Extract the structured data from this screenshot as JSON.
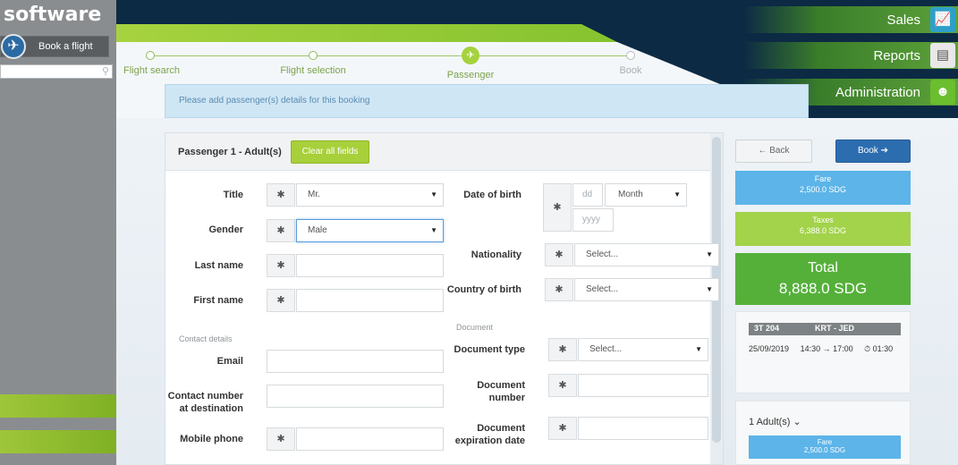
{
  "sidebar": {
    "brand": "software",
    "book_label": "Book a flight",
    "search_placeholder": ""
  },
  "nav": {
    "sales": "Sales",
    "reports": "Reports",
    "administration": "Administration"
  },
  "steps": [
    {
      "label": "Flight search"
    },
    {
      "label": "Flight selection"
    },
    {
      "label": "Passenger"
    },
    {
      "label": "Book"
    }
  ],
  "info": "Please add passenger(s) details for this booking",
  "panel": {
    "title": "Passenger 1 - Adult(s)",
    "clear_label": "Clear all fields",
    "req_mark": "✱",
    "fields": {
      "title_label": "Title",
      "title_value": "Mr.",
      "gender_label": "Gender",
      "gender_value": "Male",
      "last_name_label": "Last name",
      "first_name_label": "First name",
      "contact_section": "Contact details",
      "email_label": "Email",
      "contact_dest_label_1": "Contact number",
      "contact_dest_label_2": "at destination",
      "mobile_label": "Mobile phone",
      "dob_label": "Date of birth",
      "dob_dd": "dd",
      "dob_month": "Month",
      "dob_yyyy": "yyyy",
      "nationality_label": "Nationality",
      "nationality_value": "Select...",
      "country_label": "Country of birth",
      "country_value": "Select...",
      "document_section": "Document",
      "doc_type_label": "Document type",
      "doc_type_value": "Select...",
      "doc_number_label_1": "Document",
      "doc_number_label_2": "number",
      "doc_exp_label_1": "Document",
      "doc_exp_label_2": "expiration date"
    }
  },
  "right": {
    "back_label": "← Back",
    "book_label": "Book ➔",
    "fare_label": "Fare",
    "fare_value": "2,500.0 SDG",
    "taxes_label": "Taxes",
    "taxes_value": "6,388.0 SDG",
    "total_label": "Total",
    "total_value": "8,888.0 SDG",
    "flight_no": "3T 204",
    "route": "KRT - JED",
    "date": "25/09/2019",
    "times": "14:30 → 17:00",
    "duration": "⏱ 01:30",
    "adults_label": "1 Adult(s) ⌄",
    "adults_fare_label": "Fare",
    "adults_fare_value": "2,500.0 SDG"
  },
  "colors": {
    "navy": "#0c2a44",
    "green": "#a6d23f",
    "blue": "#2c6db0",
    "sky": "#5cb4e8"
  }
}
